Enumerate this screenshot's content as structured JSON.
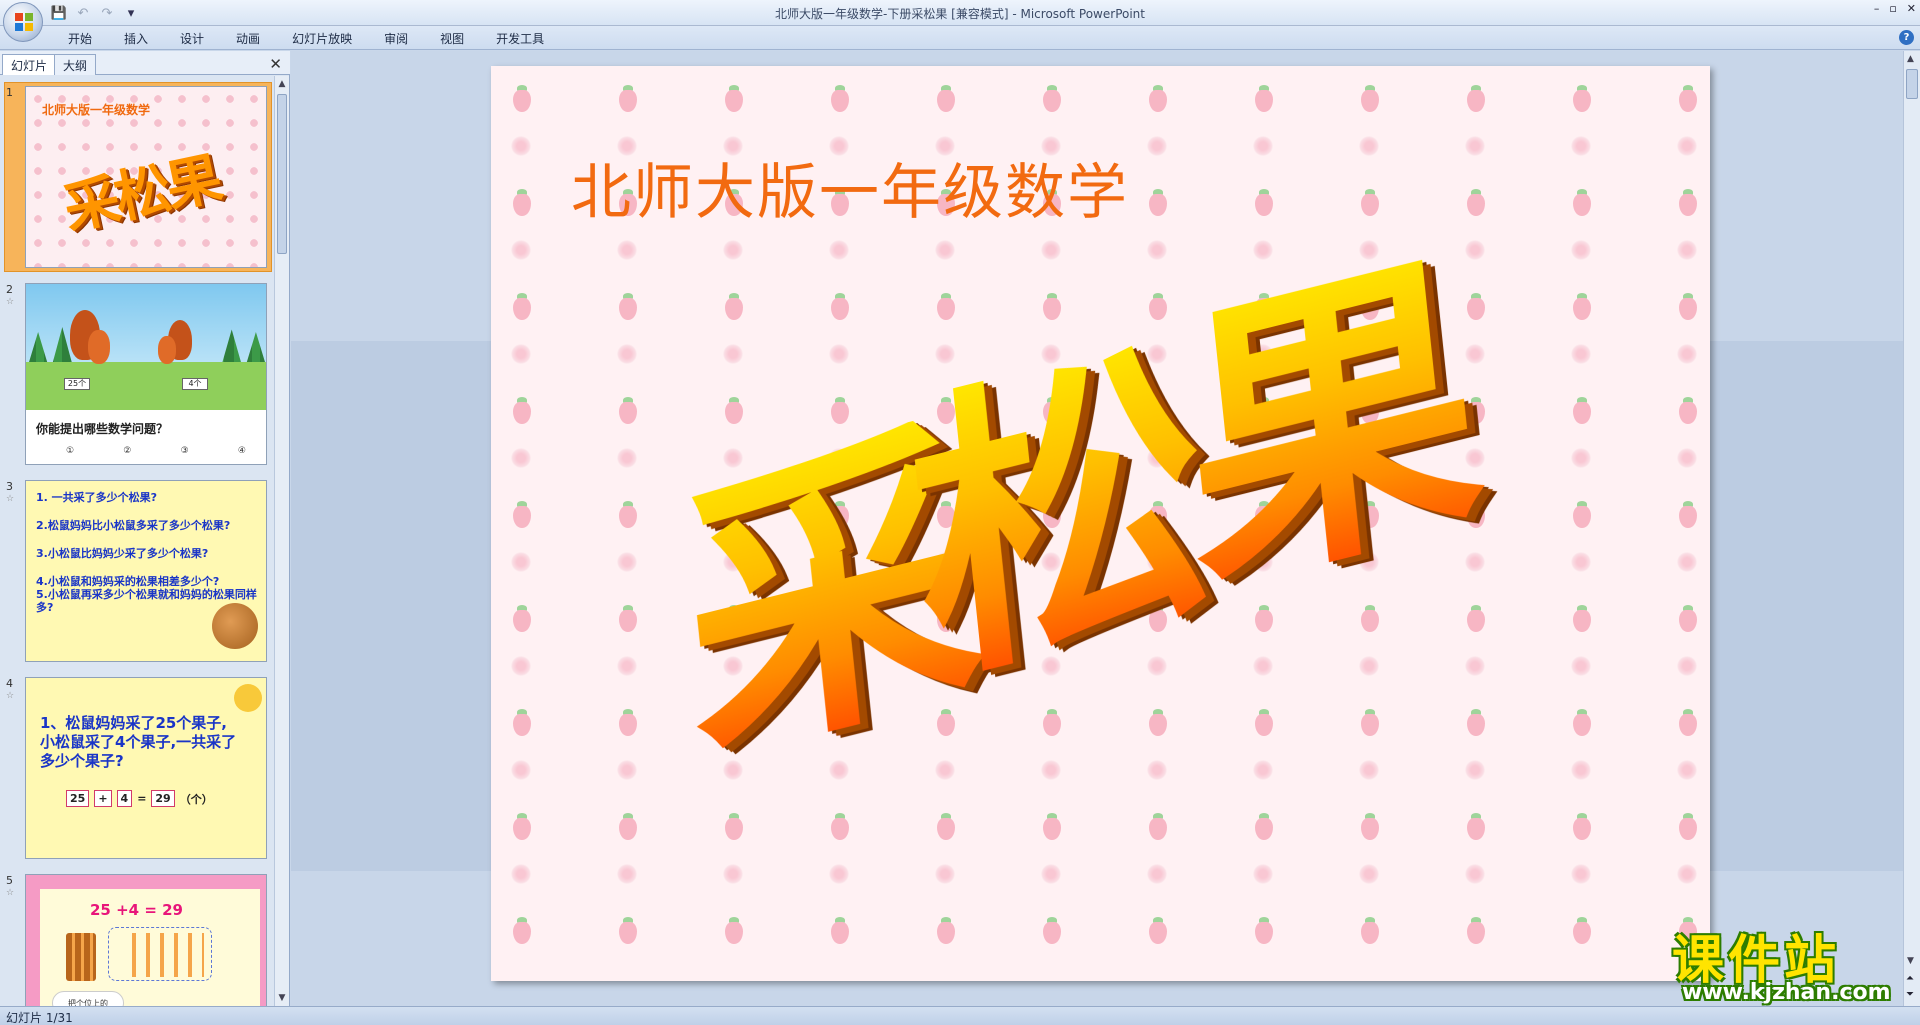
{
  "window": {
    "title": "北师大版一年级数学-下册采松果 [兼容模式] - Microsoft PowerPoint",
    "controls": [
      "–",
      "▫",
      "✕"
    ]
  },
  "quick_access": {
    "save_icon": "save-icon",
    "undo_icon": "undo-icon",
    "redo_icon": "redo-icon"
  },
  "ribbon": {
    "tabs": [
      "开始",
      "插入",
      "设计",
      "动画",
      "幻灯片放映",
      "审阅",
      "视图",
      "开发工具"
    ],
    "help": "?"
  },
  "left_pane": {
    "tab_slides": "幻灯片",
    "tab_outline": "大纲",
    "close": "✕",
    "slides": [
      {
        "num": "1",
        "title": "北师大版一年级数学",
        "big": "采松果"
      },
      {
        "num": "2",
        "sign_left": "25个",
        "sign_right": "4个",
        "caption": "你能提出哪些数学问题？",
        "options": [
          "①",
          "②",
          "③",
          "④"
        ]
      },
      {
        "num": "3",
        "items": [
          "1. 一共采了多少个松果?",
          "2.松鼠妈妈比小松鼠多采了多少个松果?",
          "3.小松鼠比妈妈少采了多少个松果?",
          "4.小松鼠和妈妈采的松果相差多少个?",
          "5.小松鼠再采多少个松果就和妈妈的松果同样多?"
        ]
      },
      {
        "num": "4",
        "text": "1、松鼠妈妈采了25个果子,小松鼠采了4个果子,一共采了多少个果子?",
        "eq": [
          "25",
          "+",
          "4",
          "=",
          "29"
        ],
        "unit": "（个）"
      },
      {
        "num": "5",
        "eq": "25 +4 = 29",
        "cloud": "把个位上的"
      }
    ]
  },
  "slide": {
    "subtitle": "北师大版一年级数学",
    "chars": [
      "采",
      "松",
      "果"
    ]
  },
  "watermark": {
    "name": "课件站",
    "url": "www.kjzhan.com"
  },
  "status": {
    "slide_counter": "幻灯片 1/31"
  }
}
